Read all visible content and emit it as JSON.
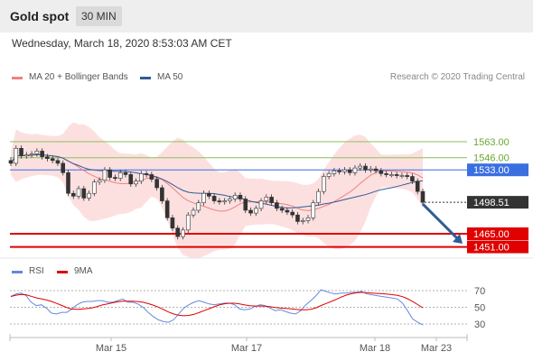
{
  "header": {
    "title": "Gold spot",
    "timeframe": "30 MIN"
  },
  "datetime": "Wednesday, March 18, 2020 8:53:03 AM CET",
  "legend": {
    "ma20": {
      "label": "MA 20 + Bollinger Bands",
      "color": "#f08080"
    },
    "ma50": {
      "label": "MA 50",
      "color": "#2e5c99"
    }
  },
  "credit": "Research © 2020 Trading Central",
  "rsi_legend": {
    "rsi": {
      "label": "RSI",
      "color": "#6688dd"
    },
    "ma": {
      "label": "9MA",
      "color": "#dd0000"
    }
  },
  "chart_data": {
    "type": "candlestick",
    "price_levels": [
      {
        "value": 1563.0,
        "label": "1563.00",
        "kind": "resistance",
        "color": "#8bbf5a"
      },
      {
        "value": 1546.0,
        "label": "1546.00",
        "kind": "resistance",
        "color": "#8bbf5a"
      },
      {
        "value": 1533.0,
        "label": "1533.00",
        "kind": "pivot",
        "color": "#3a6fe0"
      },
      {
        "value": 1498.51,
        "label": "1498.51",
        "kind": "last",
        "color": "#333333"
      },
      {
        "value": 1465.0,
        "label": "1465.00",
        "kind": "support",
        "color": "#e00000"
      },
      {
        "value": 1451.0,
        "label": "1451.00",
        "kind": "support",
        "color": "#e00000"
      }
    ],
    "x_ticks": [
      "Mar 15",
      "Mar 17",
      "Mar 18",
      "Mar 23"
    ],
    "rsi_levels": [
      70,
      50,
      30
    ],
    "rsi_range": [
      20,
      80
    ],
    "price_series": [
      1540,
      1556,
      1548,
      1549,
      1550,
      1553,
      1547,
      1545,
      1543,
      1540,
      1530,
      1508,
      1505,
      1513,
      1503,
      1508,
      1520,
      1522,
      1533,
      1525,
      1524,
      1530,
      1528,
      1518,
      1521,
      1529,
      1528,
      1523,
      1514,
      1500,
      1482,
      1471,
      1462,
      1469,
      1485,
      1490,
      1498,
      1508,
      1505,
      1500,
      1499,
      1500,
      1502,
      1506,
      1502,
      1490,
      1487,
      1492,
      1500,
      1504,
      1498,
      1492,
      1490,
      1488,
      1485,
      1478,
      1479,
      1482,
      1498,
      1510,
      1526,
      1529,
      1532,
      1531,
      1533,
      1530,
      1535,
      1537,
      1533,
      1534,
      1532,
      1529,
      1528,
      1528,
      1527,
      1527,
      1526,
      1521,
      1510,
      1498.51
    ],
    "rsi_series": [
      63,
      66,
      67,
      64,
      56,
      52,
      53,
      49,
      43,
      42,
      44,
      44,
      48,
      53,
      56,
      57,
      57,
      58,
      58,
      56,
      56,
      58,
      60,
      56,
      56,
      54,
      50,
      44,
      39,
      35,
      33,
      32,
      35,
      42,
      49,
      53,
      56,
      58,
      56,
      54,
      53,
      54,
      55,
      55,
      53,
      48,
      47,
      48,
      51,
      53,
      52,
      49,
      46,
      47,
      45,
      43,
      42,
      46,
      53,
      58,
      64,
      71,
      69,
      67,
      66,
      67,
      67,
      68,
      68,
      69,
      66,
      65,
      64,
      63,
      62,
      61,
      60,
      55,
      46,
      36,
      32,
      29
    ]
  }
}
